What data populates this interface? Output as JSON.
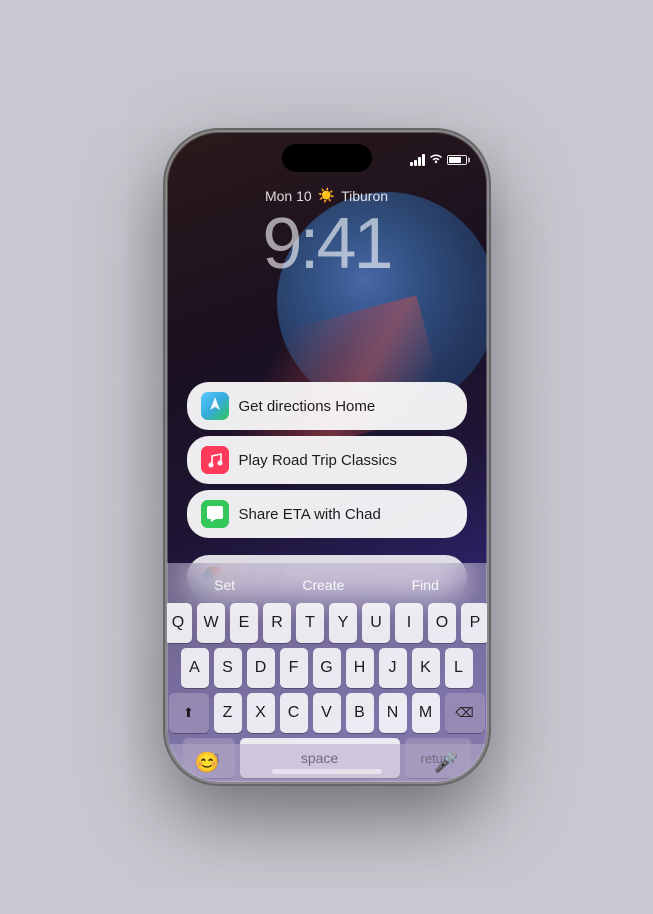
{
  "phone": {
    "status_bar": {
      "signal_label": "signal",
      "wifi_label": "wifi",
      "battery_label": "battery"
    },
    "lock_screen": {
      "date": "Mon 10",
      "weather_icon": "☀️",
      "location": "Tiburon",
      "time": "9:41"
    },
    "suggestions": [
      {
        "id": "directions",
        "icon": "maps",
        "icon_emoji": "🗺️",
        "label": "Get directions Home"
      },
      {
        "id": "music",
        "icon": "music",
        "icon_emoji": "🎵",
        "label": "Play Road Trip Classics"
      },
      {
        "id": "messages",
        "icon": "messages",
        "icon_emoji": "💬",
        "label": "Share ETA with Chad"
      }
    ],
    "siri_input": {
      "placeholder": "Ask Siri..."
    },
    "keyboard": {
      "quicktype": [
        "Set",
        "Create",
        "Find"
      ],
      "rows": [
        [
          "Q",
          "W",
          "E",
          "R",
          "T",
          "Y",
          "U",
          "I",
          "O",
          "P"
        ],
        [
          "A",
          "S",
          "D",
          "F",
          "G",
          "H",
          "J",
          "K",
          "L"
        ],
        [
          "⬆",
          "Z",
          "X",
          "C",
          "V",
          "B",
          "N",
          "M",
          "⌫"
        ],
        [
          "123",
          "space",
          "return"
        ]
      ],
      "space_label": "space",
      "return_label": "return",
      "numbers_label": "123"
    },
    "bottom_bar": {
      "emoji_icon": "😊",
      "mic_icon": "🎤"
    }
  }
}
